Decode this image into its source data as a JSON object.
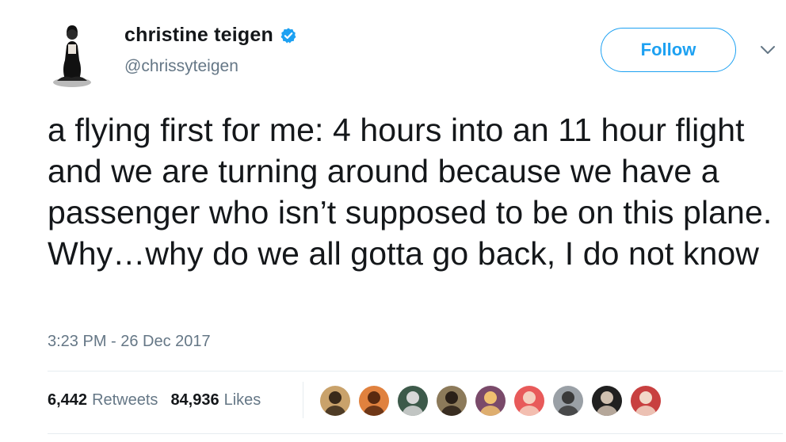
{
  "author": {
    "display_name": "christine teigen",
    "handle": "@chrissyteigen",
    "verified": true,
    "avatar_icon": "profile-photo"
  },
  "follow_button": {
    "label": "Follow"
  },
  "menu": {
    "icon": "chevron-down-icon"
  },
  "tweet": {
    "text": "a flying first for me: 4 hours into an 11 hour flight and we are turning around because we have a passenger who isn’t supposed to be on this plane. Why…why do we all gotta go back, I do not know",
    "timestamp": "3:23 PM - 26 Dec 2017"
  },
  "stats": {
    "retweets_count": "6,442",
    "retweets_label": "Retweets",
    "likes_count": "84,936",
    "likes_label": "Likes"
  },
  "likers": [
    {
      "name": "liker-avatar-1",
      "bg": "#c9a26b",
      "fg": "#3a2a1a"
    },
    {
      "name": "liker-avatar-2",
      "bg": "#e0813e",
      "fg": "#5a2a10"
    },
    {
      "name": "liker-avatar-3",
      "bg": "#3d5a4a",
      "fg": "#d8d8d8"
    },
    {
      "name": "liker-avatar-4",
      "bg": "#8c7a5a",
      "fg": "#2a2018"
    },
    {
      "name": "liker-avatar-5",
      "bg": "#7a4a6a",
      "fg": "#f0c070"
    },
    {
      "name": "liker-avatar-6",
      "bg": "#e85a5a",
      "fg": "#f5d0c0"
    },
    {
      "name": "liker-avatar-7",
      "bg": "#9aa0a6",
      "fg": "#3a3a3a"
    },
    {
      "name": "liker-avatar-8",
      "bg": "#202020",
      "fg": "#d0c0b0"
    },
    {
      "name": "liker-avatar-9",
      "bg": "#c84040",
      "fg": "#f2d8c8"
    }
  ],
  "colors": {
    "accent": "#1da1f2",
    "text": "#14171a",
    "muted": "#657786",
    "divider": "#e6ecf0"
  }
}
